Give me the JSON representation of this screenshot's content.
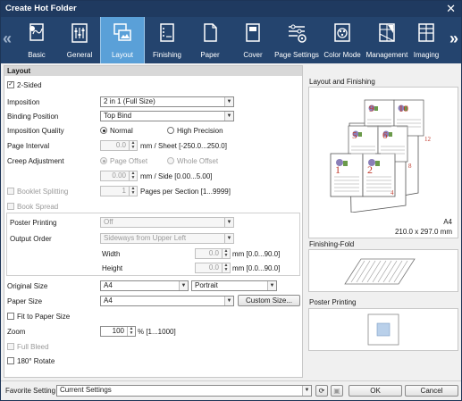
{
  "window": {
    "title": "Create Hot Folder"
  },
  "tabs": [
    {
      "label": "Basic",
      "icon": "basic-icon"
    },
    {
      "label": "General",
      "icon": "general-icon"
    },
    {
      "label": "Layout",
      "icon": "layout-icon"
    },
    {
      "label": "Finishing",
      "icon": "finishing-icon"
    },
    {
      "label": "Paper",
      "icon": "paper-icon"
    },
    {
      "label": "Cover",
      "icon": "cover-icon"
    },
    {
      "label": "Page Settings",
      "icon": "page-settings-icon"
    },
    {
      "label": "Color Mode",
      "icon": "color-mode-icon"
    },
    {
      "label": "Management",
      "icon": "management-icon"
    },
    {
      "label": "Imaging",
      "icon": "imaging-icon"
    }
  ],
  "active_tab": "Layout",
  "colors": {
    "titlebar": "#1f3a60",
    "ribbon": "#24446e",
    "active_tab": "#5aa0d8",
    "page_number": "#c0392b"
  },
  "layout": {
    "section_title": "Layout",
    "two_sided": {
      "label": "2-Sided",
      "checked": true
    },
    "imposition": {
      "label": "Imposition",
      "value": "2 in 1 (Full Size)"
    },
    "binding_position": {
      "label": "Binding Position",
      "value": "Top Bind"
    },
    "imposition_quality": {
      "label": "Imposition Quality",
      "options": [
        "Normal",
        "High Precision"
      ],
      "selected": "Normal"
    },
    "page_interval": {
      "label": "Page Interval",
      "value": "0.0",
      "unit": "mm / Sheet [-250.0...250.0]"
    },
    "creep_adjustment": {
      "label": "Creep Adjustment",
      "options": [
        "Page Offset",
        "Whole Offset"
      ],
      "selected": "Page Offset",
      "value": "0.00",
      "unit": "mm / Side [0.00...5.00]"
    },
    "booklet_splitting": {
      "label": "Booklet Splitting",
      "value": "1",
      "unit": "Pages per Section [1...9999]",
      "checked": false
    },
    "book_spread": {
      "label": "Book Spread",
      "checked": false
    },
    "poster_printing": {
      "label": "Poster Printing",
      "value": "Off"
    },
    "output_order": {
      "label": "Output Order",
      "value": "Sideways from Upper Left"
    },
    "width": {
      "label": "Width",
      "value": "0.0",
      "unit": "mm [0.0...90.0]"
    },
    "height": {
      "label": "Height",
      "value": "0.0",
      "unit": "mm [0.0...90.0]"
    },
    "original_size": {
      "label": "Original Size",
      "value": "A4",
      "orientation": "Portrait"
    },
    "paper_size": {
      "label": "Paper Size",
      "value": "A4",
      "custom_button": "Custom Size..."
    },
    "fit_to_paper_size": {
      "label": "Fit to Paper Size",
      "checked": false
    },
    "zoom": {
      "label": "Zoom",
      "value": "100",
      "unit": "% [1...1000]"
    },
    "full_bleed": {
      "label": "Full Bleed",
      "checked": false
    },
    "rotate_180": {
      "label": "180° Rotate",
      "checked": false
    }
  },
  "preview": {
    "layout_title": "Layout and Finishing",
    "page_numbers": [
      "9",
      "10",
      "5",
      "6",
      "1",
      "2",
      "4",
      "8",
      "12"
    ],
    "paper_name": "A4",
    "paper_dims": "210.0 x 297.0 mm",
    "finishing_fold_title": "Finishing-Fold",
    "poster_title": "Poster Printing"
  },
  "footer": {
    "favorite_label": "Favorite Setting",
    "favorite_value": "Current Settings",
    "ok": "OK",
    "cancel": "Cancel"
  }
}
